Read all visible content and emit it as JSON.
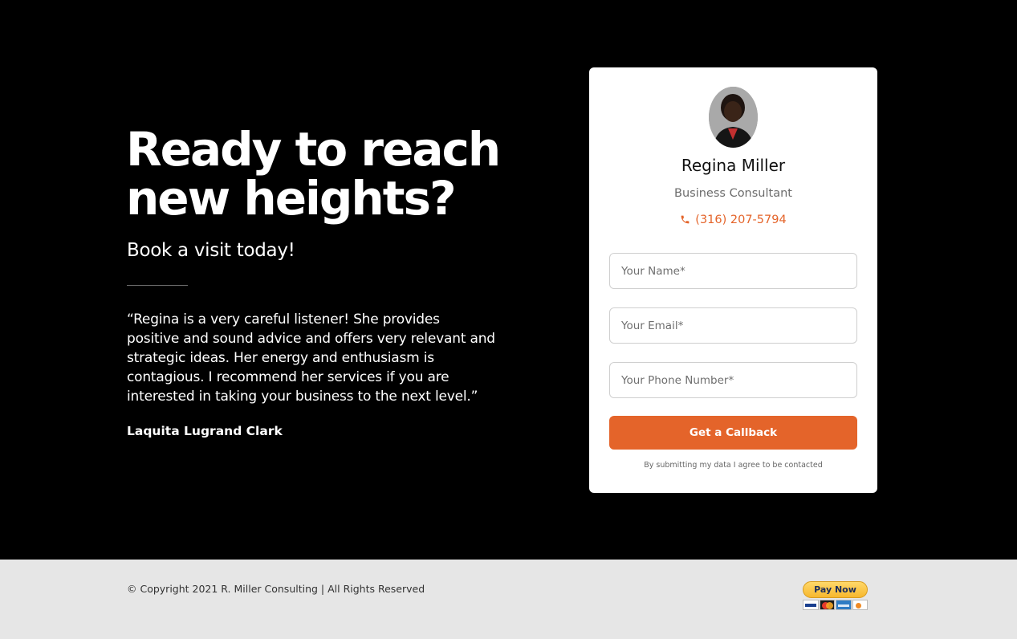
{
  "hero": {
    "headline": "Ready to reach new heights?",
    "subheading": "Book a visit today!",
    "testimonial": {
      "quote": "“Regina is a very careful listener! She provides positive and sound advice and offers very relevant and strategic ideas. Her energy and enthusiasm is contagious. I recommend her services if you are interested in taking your business to the next level.”",
      "author": "Laquita Lugrand Clark"
    }
  },
  "contact_card": {
    "name": "Regina Miller",
    "title": "Business Consultant",
    "phone": "(316) 207-5794",
    "phone_icon": "phone-icon",
    "fields": {
      "name_placeholder": "Your Name*",
      "email_placeholder": "Your Email*",
      "phone_placeholder": "Your Phone Number*"
    },
    "submit_label": "Get a Callback",
    "consent": "By submitting my data I agree to be contacted"
  },
  "footer": {
    "copyright": "© Copyright 2021 R. Miller Consulting | All Rights Reserved",
    "pay_button": "Pay Now",
    "payment_cards": [
      "visa-icon",
      "mastercard-icon",
      "amex-icon",
      "discover-icon"
    ]
  },
  "colors": {
    "accent": "#e4642a",
    "hero_background": "#000000",
    "footer_background": "#e6e6e6"
  }
}
